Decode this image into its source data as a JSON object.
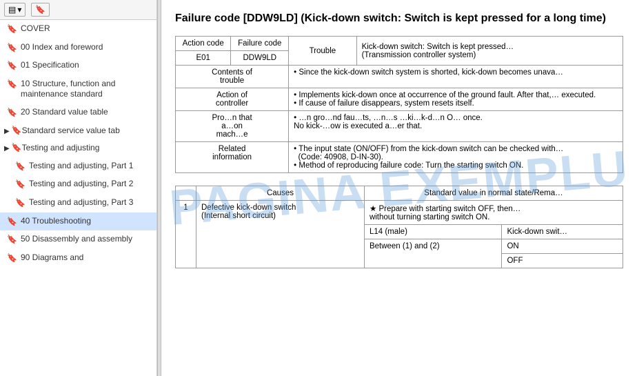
{
  "sidebar": {
    "toolbar": {
      "btn1_label": "▤ ▾",
      "btn2_label": "🔖"
    },
    "items": [
      {
        "id": "cover",
        "label": "COVER",
        "type": "item",
        "expandable": false
      },
      {
        "id": "00-index",
        "label": "00 Index and foreword",
        "type": "item",
        "expandable": false
      },
      {
        "id": "01-spec",
        "label": "01 Specification",
        "type": "item",
        "expandable": false
      },
      {
        "id": "10-structure",
        "label": "10 Structure, function and maintenance standard",
        "type": "item",
        "expandable": false
      },
      {
        "id": "20-standard",
        "label": "20 Standard value table",
        "type": "item",
        "expandable": false
      },
      {
        "id": "standard-service",
        "label": "Standard service value tab",
        "type": "expandable",
        "expandable": true
      },
      {
        "id": "testing-adj",
        "label": "Testing and adjusting",
        "type": "expandable",
        "expandable": true
      },
      {
        "id": "testing-p1",
        "label": "Testing and adjusting, Part 1",
        "type": "item",
        "expandable": false,
        "indent": true
      },
      {
        "id": "testing-p2",
        "label": "Testing and adjusting, Part 2",
        "type": "item",
        "expandable": false,
        "indent": true
      },
      {
        "id": "testing-p3",
        "label": "Testing and adjusting, Part 3",
        "type": "item",
        "expandable": false,
        "indent": true
      },
      {
        "id": "40-trouble",
        "label": "40 Troubleshooting",
        "type": "item",
        "expandable": false,
        "active": true
      },
      {
        "id": "50-disassembly",
        "label": "50 Disassembly and assembly",
        "type": "item",
        "expandable": false
      },
      {
        "id": "90-diagrams",
        "label": "90 Diagrams and",
        "type": "item",
        "expandable": false
      }
    ]
  },
  "main": {
    "title": "Failure code [DDW9LD] (Kick-down switch: Switch is kept pressed for a long time)",
    "title_short": "Failure code [DDW9LD] (Kick-down switch: Switch is ke…\nlong time)",
    "watermark": "PAGINA EXEMPLU",
    "table1": {
      "headers": [
        "Action code",
        "Failure code",
        "Trouble"
      ],
      "action_code": "E01",
      "failure_code": "DDW9LD",
      "trouble_desc": "Kick-down switch: Switch is kept pressed… (Transmission controller system)",
      "rows": [
        {
          "label": "Contents of trouble",
          "content": "Since the kick-down switch system is shorted, kick-down becomes unava…"
        },
        {
          "label": "Action of controller",
          "content": "• Implements kick-down once at occurrence of the ground fault. After that,… executed.\n• If cause of failure disappears, system resets itself."
        },
        {
          "label": "Problem that appears on machine",
          "content": "• …n gro…nd fau…ts, …n…s …ki…k-d…n O… once.\nNo kick-down is executed a…er that."
        },
        {
          "label": "Related information",
          "content": "• The input state (ON/OFF) from the kick-down switch can be checked with… (Code: 40908, D-IN-30).\n• Method of reproducing failure code: Turn the starting switch ON."
        }
      ]
    },
    "table2": {
      "headers": [
        "",
        "Causes",
        "Standard value in normal state/Rema…"
      ],
      "rows": [
        {
          "num": "1",
          "cause": "Defective kick-down switch (Internal short circuit)",
          "sub_rows": [
            {
              "condition": "★ Prepare with starting switch OFF, then… without turning starting switch ON.",
              "measurement": "",
              "value": ""
            },
            {
              "label": "L14 (male)",
              "sub": "Kick-down swit…"
            },
            {
              "label": "Between (1) and (2)",
              "val1": "ON",
              "val2": "OFF"
            }
          ]
        }
      ]
    }
  }
}
